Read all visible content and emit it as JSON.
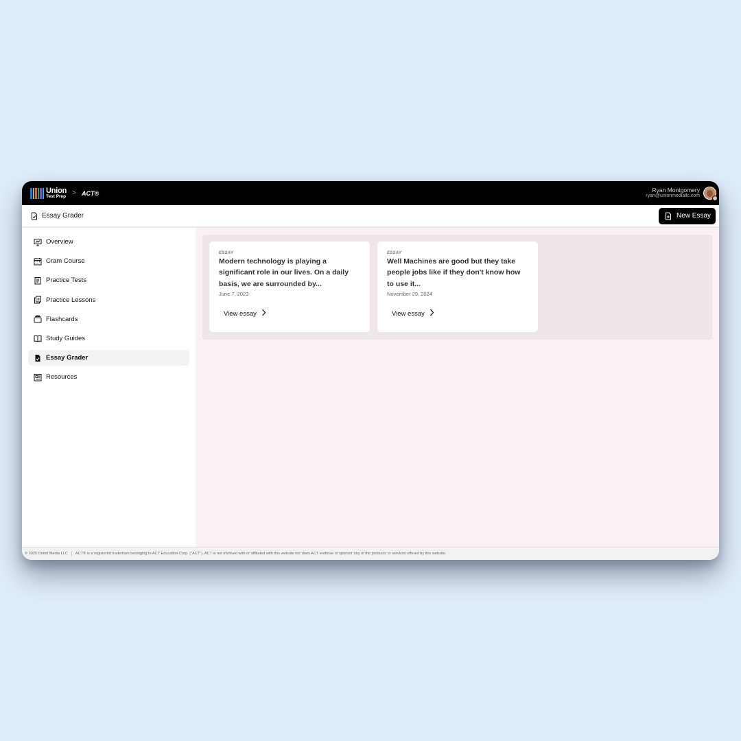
{
  "app": {
    "logo_line1": "Union",
    "logo_line2": "Test Prep",
    "breadcrumb_sep": ">",
    "product": "ACT®",
    "logo_colors": [
      "#1f7fc2",
      "#f2a11a",
      "#e05a2a",
      "#2aa36b",
      "#7a4fc0",
      "#2bbbd9"
    ]
  },
  "user": {
    "name": "Ryan Montgomery",
    "email": "ryan@unionmediallc.com"
  },
  "header": {
    "title": "Essay Grader",
    "title_icon": "document-check-icon",
    "new_button_label": "New Essay",
    "new_button_icon": "document-plus-icon"
  },
  "sidebar": {
    "items": [
      {
        "label": "Overview",
        "icon": "chart-board-icon",
        "active": false
      },
      {
        "label": "Cram Course",
        "icon": "calendar-icon",
        "active": false
      },
      {
        "label": "Practice Tests",
        "icon": "clipboard-list-icon",
        "active": false
      },
      {
        "label": "Practice Lessons",
        "icon": "clipboard-copy-icon",
        "active": false
      },
      {
        "label": "Flashcards",
        "icon": "cards-stack-icon",
        "active": false
      },
      {
        "label": "Study Guides",
        "icon": "open-book-icon",
        "active": false
      },
      {
        "label": "Essay Grader",
        "icon": "document-check-icon",
        "active": true
      },
      {
        "label": "Resources",
        "icon": "newspaper-icon",
        "active": false
      }
    ]
  },
  "essays": [
    {
      "tag": "ESSAY",
      "title": "Modern technology is playing a significant role in our lives. On a daily basis, we are surrounded by...",
      "date": "June 7, 2023",
      "link_label": "View essay"
    },
    {
      "tag": "ESSAY",
      "title": "Well Machines are good but they take people jobs like if they don't know how to use it...",
      "date": "November 29, 2024",
      "link_label": "View essay"
    }
  ],
  "footer": {
    "copyright": "© 2025 Union Media LLC",
    "disclaimer": "ACT® is a registered trademark belonging to ACT Education Corp. (\"ACT\"). ACT is not involved with or affiliated with this website nor does ACT endorse or sponsor any of the products or services offered by this website."
  }
}
